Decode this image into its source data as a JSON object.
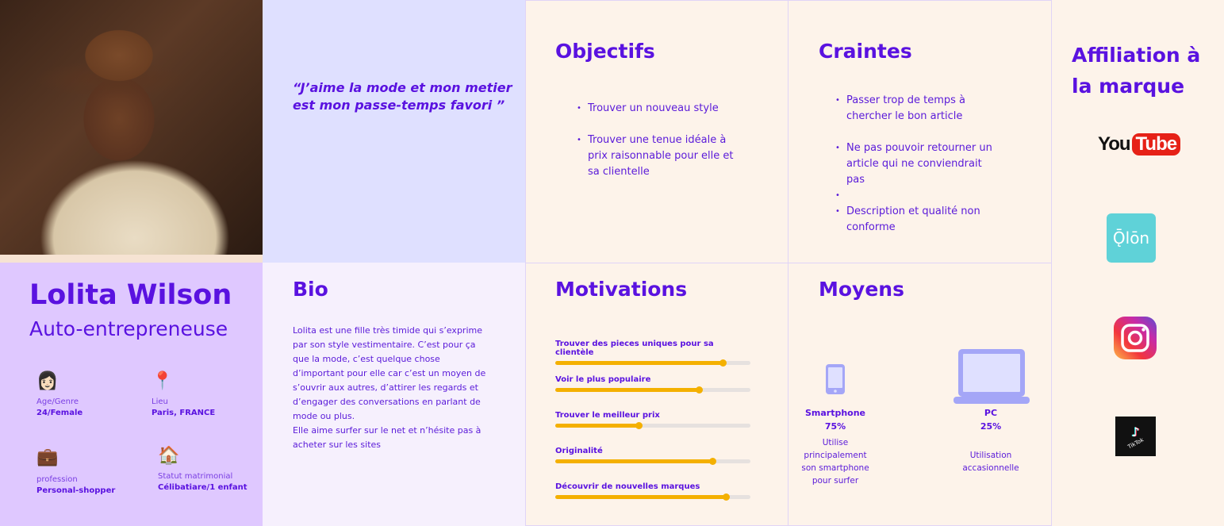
{
  "persona": {
    "name": "Lolita Wilson",
    "role": "Auto-entrepreneuse",
    "attributes": [
      {
        "icon": "woman-icon",
        "label": "Age/Genre",
        "value": "24/Female"
      },
      {
        "icon": "pin-icon",
        "label": "Lieu",
        "value": "Paris, FRANCE"
      },
      {
        "icon": "briefcase-icon",
        "label": "profession",
        "value": "Personal-shopper"
      },
      {
        "icon": "house-icon",
        "label": "Statut matrimonial",
        "value": "Célibatiare/1 enfant"
      }
    ]
  },
  "quote": "“J’aime la mode  et  mon metier est mon passe-temps favori ”",
  "bio": {
    "title": "Bio",
    "text1": "Lolita est une fille très timide qui s’exprime par son style vestimentaire.   C’est pour ça que la mode, c’est quelque chose d’important pour elle car c’est un moyen de s’ouvrir aux autres, d’attirer les regards et d’engager des conversations en parlant de mode ou plus.",
    "text2": "Elle aime surfer sur le net et n’hésite pas à acheter sur les sites"
  },
  "objectifs": {
    "title": "Objectifs",
    "items": [
      "Trouver un nouveau style",
      "Trouver une tenue idéale à prix raisonnable pour elle et sa clientelle"
    ]
  },
  "craintes": {
    "title": "Craintes",
    "items": [
      "Passer trop de temps à chercher le bon article",
      "Ne pas pouvoir retourner un article qui ne conviendrait pas",
      "",
      "Description et qualité non conforme"
    ]
  },
  "motivations": {
    "title": "Motivations",
    "items": [
      {
        "label": "Trouver des pieces uniques pour sa clientèle",
        "level": 0.86
      },
      {
        "label": "Voir le plus populaire",
        "level": 0.74
      },
      {
        "label": "Trouver le meilleur prix",
        "level": 0.43
      },
      {
        "label": "Originalité",
        "level": 0.81
      },
      {
        "label": "Découvrir de nouvelles marques",
        "level": 0.88
      }
    ]
  },
  "moyens": {
    "title": "Moyens",
    "devices": [
      {
        "icon": "smartphone-icon",
        "name": "Smartphone",
        "percent": "75%",
        "note": "Utilise principalement son smartphone pour surfer"
      },
      {
        "icon": "laptop-icon",
        "name": "PC",
        "percent": "25%",
        "note": "Utilisation accasionnelle"
      }
    ]
  },
  "affiliation": {
    "title": "Affiliation à la marque",
    "brands": {
      "youtube_a": "You",
      "youtube_b": "Tube",
      "qlon": "Ǭlōn",
      "tiktok": "TikTok"
    }
  },
  "colors": {
    "accent": "#5a12e0",
    "bar": "#f4b000",
    "panel_purple": "#dfc8ff",
    "panel_blue": "#dfe0ff"
  }
}
